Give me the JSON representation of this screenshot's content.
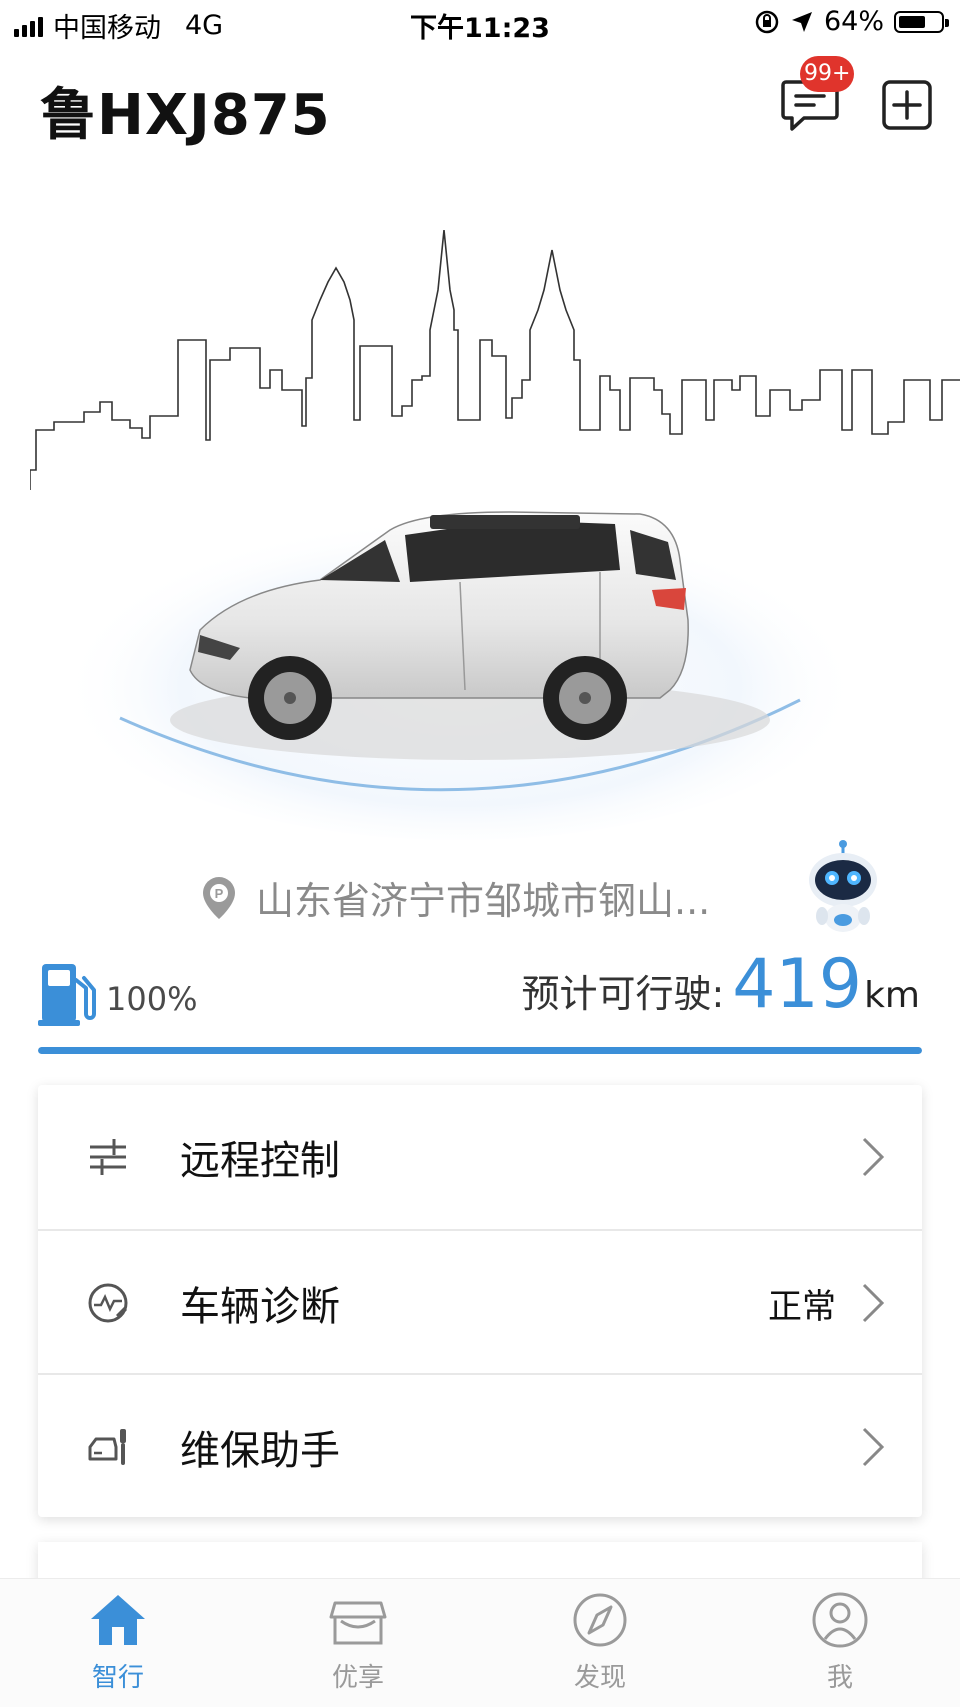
{
  "status_bar": {
    "carrier": "中国移动",
    "network": "4G",
    "time": "下午11:23",
    "battery_percent": "64%",
    "battery_level": 0.64
  },
  "header": {
    "plate": "鲁HXJ875",
    "message_badge": "99+"
  },
  "location": {
    "address": "山东省济宁市邹城市钢山..."
  },
  "fuel": {
    "percent_label": "100%",
    "level": 1.0,
    "range_label": "预计可行驶:",
    "range_value": "419",
    "range_unit": "km"
  },
  "menu": {
    "items": [
      {
        "label": "远程控制",
        "icon": "sliders-icon",
        "value": ""
      },
      {
        "label": "车辆诊断",
        "icon": "diagnosis-gauge-icon",
        "value": "正常"
      },
      {
        "label": "维保助手",
        "icon": "car-maintenance-icon",
        "value": ""
      }
    ]
  },
  "tabs": [
    {
      "label": "智行",
      "icon": "home-icon",
      "active": true
    },
    {
      "label": "优享",
      "icon": "store-icon",
      "active": false
    },
    {
      "label": "发现",
      "icon": "compass-icon",
      "active": false
    },
    {
      "label": "我",
      "icon": "user-icon",
      "active": false
    }
  ],
  "colors": {
    "accent": "#3b8fd8",
    "badge": "#e0342c",
    "inactive": "#9a9a9a"
  }
}
